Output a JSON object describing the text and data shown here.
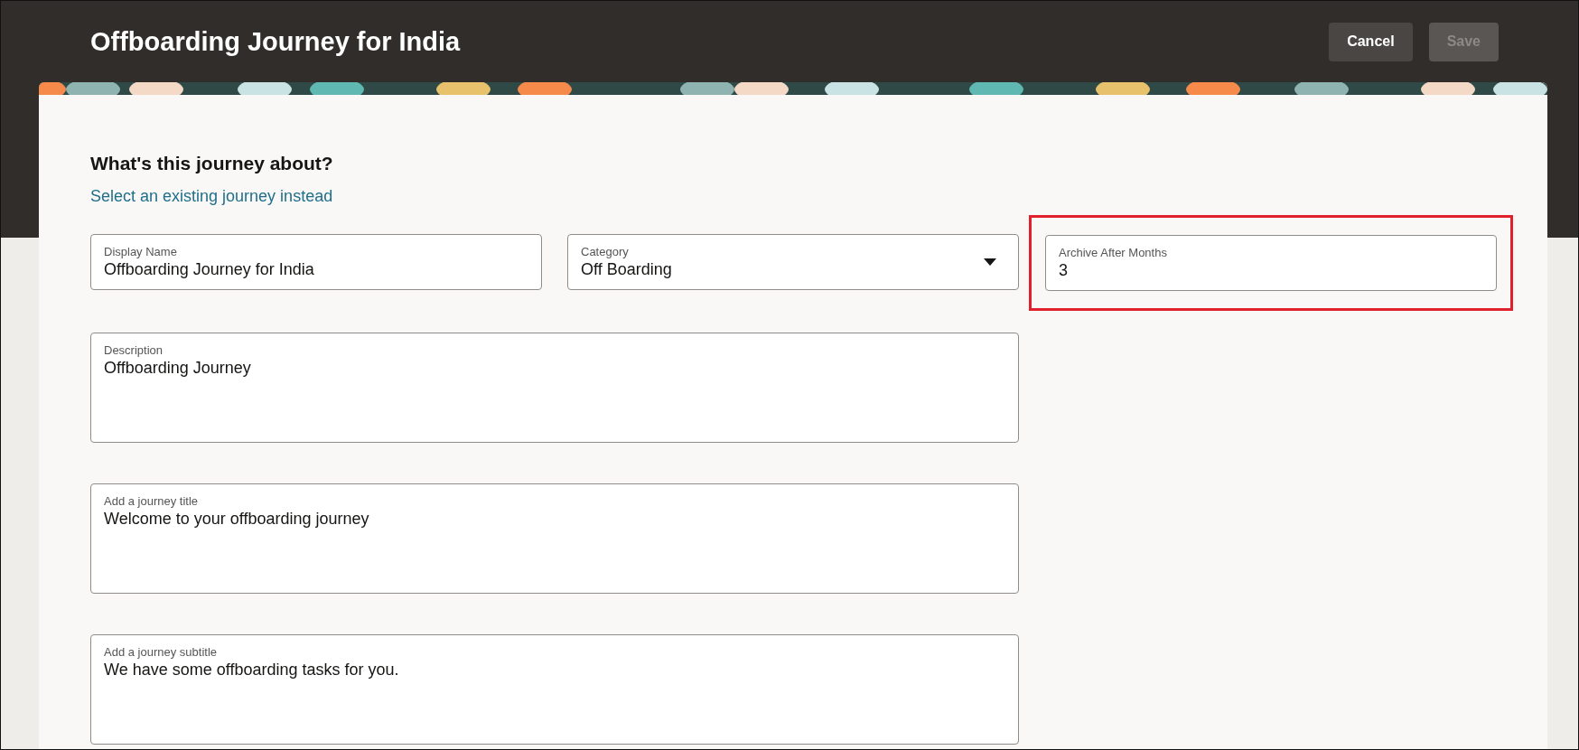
{
  "header": {
    "title": "Offboarding Journey for India",
    "buttons": [
      {
        "label": "Cancel",
        "disabled": false
      },
      {
        "label": "Save",
        "disabled": true
      }
    ]
  },
  "form": {
    "heading": "What's this journey about?",
    "link": "Select an existing journey instead",
    "rows": [
      [
        {
          "kind": "text",
          "label": "Display Name",
          "value": "Offboarding Journey for India",
          "highlighted": false
        },
        {
          "kind": "select",
          "label": "Category",
          "value": "Off Boarding",
          "highlighted": false
        },
        {
          "kind": "text",
          "label": "Archive After Months",
          "value": "3",
          "highlighted": true
        }
      ],
      [
        {
          "kind": "area",
          "label": "Description",
          "value": "Offboarding Journey",
          "highlighted": false
        }
      ],
      [
        {
          "kind": "area",
          "label": "Add a journey title",
          "value": "Welcome to your offboarding journey",
          "highlighted": false
        }
      ],
      [
        {
          "kind": "area",
          "label": "Add a journey subtitle",
          "value": "We have some offboarding tasks for you.",
          "highlighted": false
        }
      ]
    ]
  }
}
